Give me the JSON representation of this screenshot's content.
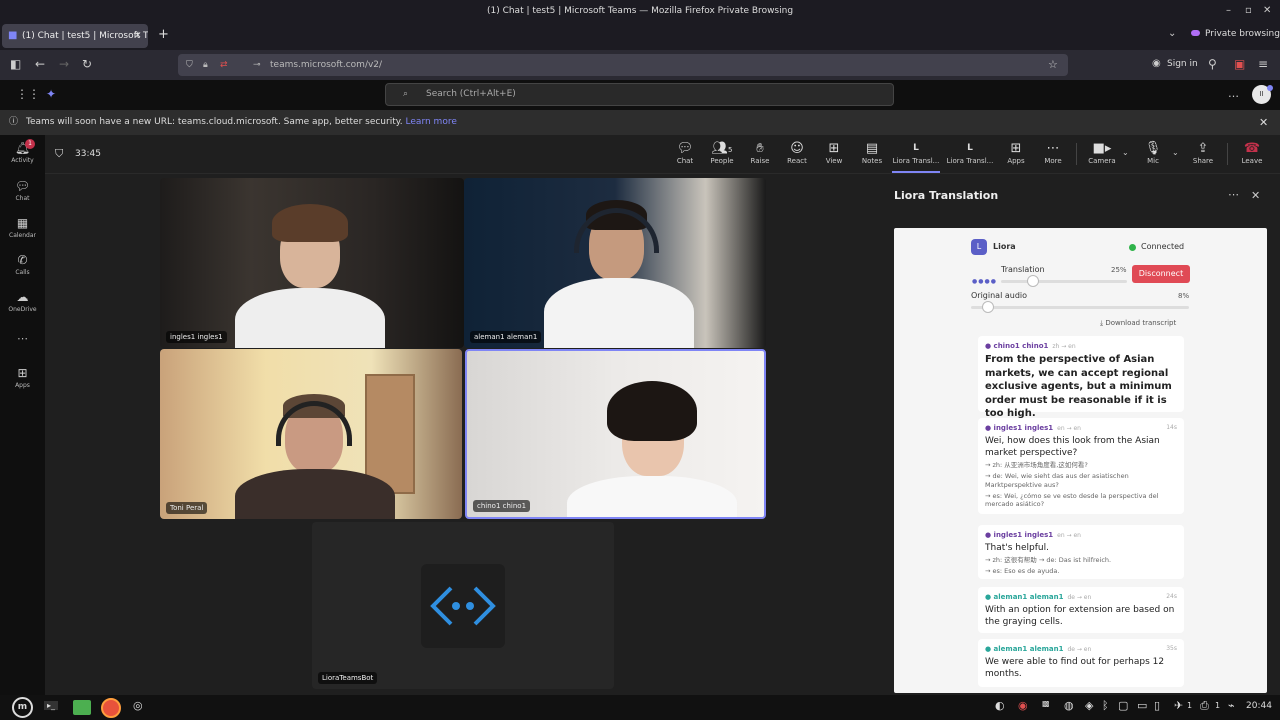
{
  "window": {
    "title": "(1) Chat | test5 | Microsoft Teams — Mozilla Firefox Private Browsing",
    "tab_title": "(1) Chat | test5 | Microsoft T",
    "private_label": "Private browsing"
  },
  "navbar": {
    "url": "teams.microsoft.com/v2/",
    "signin": "Sign in"
  },
  "teams": {
    "search_placeholder": "Search (Ctrl+Alt+E)",
    "avatar_initials": "II"
  },
  "notice": {
    "text": "Teams will soon have a new URL: teams.cloud.microsoft. Same app, better security.",
    "link": "Learn more"
  },
  "rail": [
    {
      "label": "Activity",
      "icon": "bell-icon",
      "badge": "1"
    },
    {
      "label": "Chat",
      "icon": "chat-icon"
    },
    {
      "label": "Calendar",
      "icon": "calendar-icon"
    },
    {
      "label": "Calls",
      "icon": "phone-icon"
    },
    {
      "label": "OneDrive",
      "icon": "cloud-icon"
    },
    {
      "label": "Apps",
      "icon": "apps-icon"
    }
  ],
  "meeting": {
    "timer": "33:45",
    "toolbar": [
      {
        "label": "Chat"
      },
      {
        "label": "People",
        "count": "5"
      },
      {
        "label": "Raise"
      },
      {
        "label": "React"
      },
      {
        "label": "View"
      },
      {
        "label": "Notes"
      },
      {
        "label": "Liora Transl...",
        "letter": "L"
      },
      {
        "label": "Liora Transl...",
        "letter": "L"
      },
      {
        "label": "Apps"
      },
      {
        "label": "More"
      },
      {
        "label": "Camera"
      },
      {
        "label": "Mic"
      },
      {
        "label": "Share"
      },
      {
        "label": "Leave"
      }
    ]
  },
  "participants": [
    {
      "name": "ingles1 ingles1"
    },
    {
      "name": "aleman1 aleman1"
    },
    {
      "name": "Toni Peral"
    },
    {
      "name": "chino1 chino1"
    },
    {
      "name": "LioraTeamsBot"
    }
  ],
  "panel": {
    "title": "Liora Translation",
    "app_name": "Liora",
    "app_letter": "L",
    "status": "Connected",
    "translation_label": "Translation",
    "translation_pct": "25%",
    "translation_level": 0.25,
    "audio_label": "Original audio",
    "audio_pct": "8%",
    "audio_level": 0.08,
    "disconnect": "Disconnect",
    "download": "Download transcript",
    "messages": [
      {
        "speaker": "chino1 chino1",
        "meta": "zh → en",
        "text": "From the perspective of Asian markets, we can accept regional exclusive agents, but a minimum order must be reasonable if it is too high.",
        "translations": []
      },
      {
        "speaker": "ingles1 ingles1",
        "meta": "en → en",
        "time": "14s",
        "text": "Wei, how does this look from the Asian market perspective?",
        "translations": [
          "→ zh: 从亚洲市场角度看,这如何看?",
          "→ de: Wei, wie sieht das aus der asiatischen Marktperspektive aus?",
          "→ es: Wei, ¿cómo se ve esto desde la perspectiva del mercado asiático?"
        ]
      },
      {
        "speaker": "ingles1 ingles1",
        "meta": "en → en",
        "text": "That's helpful.",
        "translations": [
          "→ zh: 这很有帮助     → de: Das ist hilfreich.",
          "→ es: Eso es de ayuda."
        ]
      },
      {
        "speaker": "aleman1 aleman1",
        "meta": "de → en",
        "time": "24s",
        "text": "With an option for extension are based on the graying cells.",
        "translations": []
      },
      {
        "speaker": "aleman1 aleman1",
        "meta": "de → en",
        "time": "35s",
        "text": "We were able to find out for perhaps 12 months.",
        "translations": []
      }
    ]
  },
  "taskbar": {
    "clock": "20:44",
    "num_a": "1",
    "num_b": "1"
  },
  "colors": {
    "accent": "#7f85f5",
    "leave": "#c4314b",
    "disconnect": "#e04a55",
    "connected": "#2fb34a",
    "teams_bg": "#1f1f1f"
  }
}
